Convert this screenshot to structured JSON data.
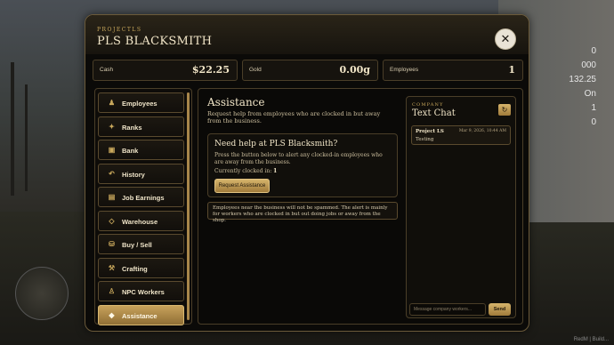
{
  "header": {
    "subtitle": "PROJECTLS",
    "title": "PLS BLACKSMITH",
    "close_icon": "close-icon"
  },
  "stats": [
    {
      "label": "Cash",
      "value": "$22.25"
    },
    {
      "label": "Gold",
      "value": "0.00g"
    },
    {
      "label": "Employees",
      "value": "1"
    }
  ],
  "sidebar": {
    "items": [
      {
        "label": "Employees",
        "icon": "person-icon"
      },
      {
        "label": "Ranks",
        "icon": "ranks-icon"
      },
      {
        "label": "Bank",
        "icon": "bank-icon"
      },
      {
        "label": "History",
        "icon": "history-icon"
      },
      {
        "label": "Job Earnings",
        "icon": "ledger-icon"
      },
      {
        "label": "Warehouse",
        "icon": "warehouse-icon"
      },
      {
        "label": "Buy / Sell",
        "icon": "bag-icon"
      },
      {
        "label": "Crafting",
        "icon": "hammers-icon"
      },
      {
        "label": "NPC Workers",
        "icon": "worker-icon"
      },
      {
        "label": "Assistance",
        "icon": "diamond-icon",
        "active": true
      }
    ]
  },
  "main": {
    "title": "Assistance",
    "description": "Request help from employees who are clocked in but away from the business.",
    "help_card": {
      "heading": "Need help at PLS Blacksmith?",
      "text": "Press the button below to alert any clocked-in employees who are away from the business.",
      "clocked_label": "Currently clocked in:",
      "clocked_value": "1",
      "button_label": "Request Assistance"
    },
    "note": "Employees near the business will not be spammed. The alert is mainly for workers who are clocked in but out doing jobs or away from the shop."
  },
  "chat": {
    "subtitle": "COMPANY",
    "title": "Text Chat",
    "messages": [
      {
        "author": "Project LS",
        "time": "Mar 9, 2026, 10:44 AM",
        "body": "Testing"
      }
    ],
    "input_placeholder": "Message company workers...",
    "send_label": "Send"
  },
  "hud": {
    "values": [
      "0",
      "000",
      "132.25",
      "On",
      "1",
      "0"
    ]
  },
  "watermark": "RedM | Build..."
}
